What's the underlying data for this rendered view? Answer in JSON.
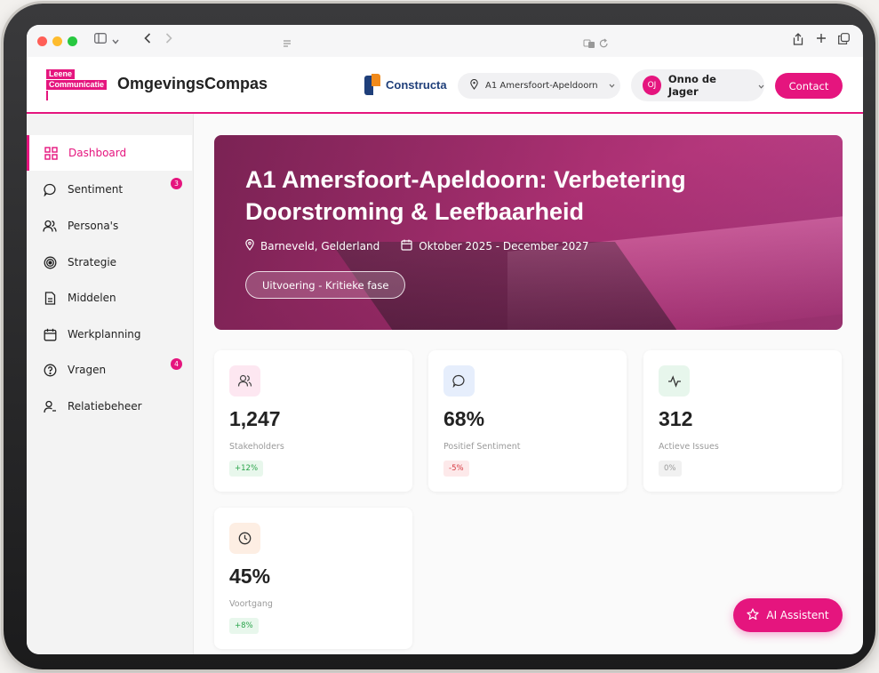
{
  "colors": {
    "accent": "#e5157e",
    "constructa_blue": "#1f3f7a",
    "constructa_orange": "#f08a1c"
  },
  "header": {
    "logo_line1": "Leene",
    "logo_line2": "Communicatie",
    "app_name": "OmgevingsCompas",
    "partner": "Constructa",
    "project_selector": "A1 Amersfoort-Apeldoorn",
    "user_initials": "OJ",
    "user_name": "Onno de Jager",
    "contact_label": "Contact"
  },
  "sidebar": {
    "items": [
      {
        "label": "Dashboard",
        "icon": "dashboard-grid-icon",
        "active": true
      },
      {
        "label": "Sentiment",
        "icon": "chat-bubble-icon",
        "badge": "3"
      },
      {
        "label": "Persona's",
        "icon": "users-icon"
      },
      {
        "label": "Strategie",
        "icon": "target-icon"
      },
      {
        "label": "Middelen",
        "icon": "document-icon"
      },
      {
        "label": "Werkplanning",
        "icon": "calendar-icon"
      },
      {
        "label": "Vragen",
        "icon": "question-circle-icon",
        "badge": "4"
      },
      {
        "label": "Relatiebeheer",
        "icon": "user-contact-icon"
      }
    ]
  },
  "hero": {
    "title": "A1 Amersfoort-Apeldoorn: Verbetering Doorstroming & Leefbaarheid",
    "location": "Barneveld, Gelderland",
    "period": "Oktober 2025 - December 2027",
    "phase": "Uitvoering - Kritieke fase"
  },
  "stats": [
    {
      "value": "1,247",
      "label": "Stakeholders",
      "delta": "+12%",
      "trend": "positive",
      "icon": "users-icon"
    },
    {
      "value": "68%",
      "label": "Positief Sentiment",
      "delta": "-5%",
      "trend": "negative",
      "icon": "chat-bubble-icon"
    },
    {
      "value": "312",
      "label": "Actieve Issues",
      "delta": "0%",
      "trend": "neutral",
      "icon": "activity-icon"
    },
    {
      "value": "45%",
      "label": "Voortgang",
      "delta": "+8%",
      "trend": "positive",
      "icon": "clock-icon"
    }
  ],
  "ai_button_label": "AI Assistent"
}
